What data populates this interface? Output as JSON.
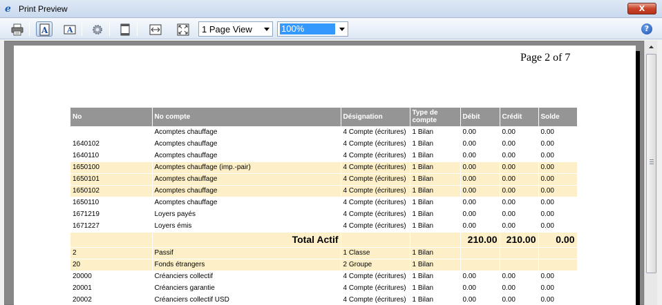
{
  "window": {
    "title": "Print Preview",
    "close_label": "X"
  },
  "toolbar": {
    "view_mode": "1 Page View",
    "zoom": "100%",
    "help_label": "?"
  },
  "page": {
    "label": "Page 2 of 7"
  },
  "table": {
    "headers": [
      "No",
      "No compte",
      "Désignation",
      "Type de compte",
      "Débit",
      "Crédit",
      "Solde"
    ],
    "rows": [
      {
        "no": "",
        "compte": "Acomptes chauffage",
        "designation": "4 Compte (écritures)",
        "type": "1 Bilan",
        "debit": "0.00",
        "credit": "0.00",
        "solde": "0.00"
      },
      {
        "no": "1640102",
        "compte": "Acomptes chauffage",
        "designation": "4 Compte (écritures)",
        "type": "1 Bilan",
        "debit": "0.00",
        "credit": "0.00",
        "solde": "0.00"
      },
      {
        "no": "1640110",
        "compte": "Acomptes chauffage",
        "designation": "4 Compte (écritures)",
        "type": "1 Bilan",
        "debit": "0.00",
        "credit": "0.00",
        "solde": "0.00"
      },
      {
        "no": "1650100",
        "compte": "Acomptes chauffage (imp.-pair)",
        "designation": "4 Compte (écritures)",
        "type": "1 Bilan",
        "debit": "0.00",
        "credit": "0.00",
        "solde": "0.00"
      },
      {
        "no": "1650101",
        "compte": "Acomptes chauffage",
        "designation": "4 Compte (écritures)",
        "type": "1 Bilan",
        "debit": "0.00",
        "credit": "0.00",
        "solde": "0.00"
      },
      {
        "no": "1650102",
        "compte": "Acomptes chauffage",
        "designation": "4 Compte (écritures)",
        "type": "1 Bilan",
        "debit": "0.00",
        "credit": "0.00",
        "solde": "0.00"
      },
      {
        "no": "1650110",
        "compte": "Acomptes chauffage",
        "designation": "4 Compte (écritures)",
        "type": "1 Bilan",
        "debit": "0.00",
        "credit": "0.00",
        "solde": "0.00"
      },
      {
        "no": "1671219",
        "compte": "Loyers payés",
        "designation": "4 Compte (écritures)",
        "type": "1 Bilan",
        "debit": "0.00",
        "credit": "0.00",
        "solde": "0.00"
      },
      {
        "no": "1671227",
        "compte": "Loyers émis",
        "designation": "4 Compte (écritures)",
        "type": "1 Bilan",
        "debit": "0.00",
        "credit": "0.00",
        "solde": "0.00"
      }
    ],
    "total": {
      "label": "Total Actif",
      "debit": "210.00",
      "credit": "210.00",
      "solde": "0.00"
    },
    "rows_after": [
      {
        "no": "2",
        "compte": "Passif",
        "designation": "1 Classe",
        "type": "1 Bilan",
        "debit": "",
        "credit": "",
        "solde": ""
      },
      {
        "no": "20",
        "compte": "Fonds étrangers",
        "designation": "2 Groupe",
        "type": "1 Bilan",
        "debit": "",
        "credit": "",
        "solde": ""
      },
      {
        "no": "20000",
        "compte": "Créanciers collectif",
        "designation": "4 Compte (écritures)",
        "type": "1 Bilan",
        "debit": "0.00",
        "credit": "0.00",
        "solde": "0.00"
      },
      {
        "no": "20001",
        "compte": "Créanciers garantie",
        "designation": "4 Compte (écritures)",
        "type": "1 Bilan",
        "debit": "0.00",
        "credit": "0.00",
        "solde": "0.00"
      },
      {
        "no": "20002",
        "compte": "Créanciers collectif USD",
        "designation": "4 Compte (écritures)",
        "type": "1 Bilan",
        "debit": "0.00",
        "credit": "0.00",
        "solde": "0.00"
      }
    ]
  },
  "colors": {
    "header_bg": "#959595",
    "highlight_row": "#fdf0c8",
    "zoom_selection": "#3399ff"
  }
}
